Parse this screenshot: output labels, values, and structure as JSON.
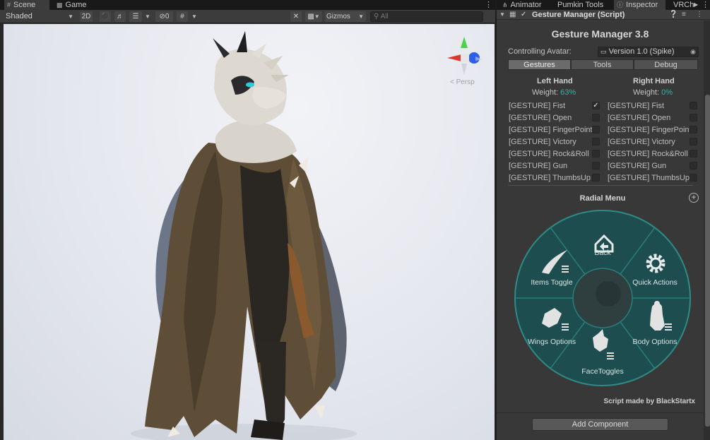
{
  "scene_tabs": [
    {
      "label": "Scene",
      "icon": "hash-grid-icon"
    },
    {
      "label": "Game",
      "icon": "gamepad-icon"
    }
  ],
  "toolbar": {
    "shading_mode": "Shaded",
    "two_d": "2D",
    "hidden_count": "0",
    "gizmos": "Gizmos",
    "search_placeholder": "All"
  },
  "viewport": {
    "persp_label": "< Persp"
  },
  "inspector_tabs": [
    {
      "label": "Animator",
      "icon": "animator-icon"
    },
    {
      "label": "Pumkin Tools",
      "icon": ""
    },
    {
      "label": "Inspector",
      "icon": "info-icon"
    },
    {
      "label": "VRCh",
      "icon": ""
    }
  ],
  "component": {
    "title": "Gesture Manager (Script)",
    "enabled": true
  },
  "gesture_manager": {
    "title": "Gesture Manager 3.8",
    "controlling_avatar_label": "Controlling Avatar:",
    "controlling_avatar_value": "Version 1.0 (Spike)",
    "modes": [
      "Gestures",
      "Tools",
      "Debug"
    ],
    "active_mode": "Gestures",
    "left_hand": {
      "title": "Left Hand",
      "weight_label": "Weight:",
      "weight_value": "63%",
      "gestures": [
        {
          "label": "[GESTURE] Fist",
          "checked": true
        },
        {
          "label": "[GESTURE] Open",
          "checked": false
        },
        {
          "label": "[GESTURE] FingerPoint",
          "checked": false
        },
        {
          "label": "[GESTURE] Victory",
          "checked": false
        },
        {
          "label": "[GESTURE] Rock&Roll",
          "checked": false
        },
        {
          "label": "[GESTURE] Gun",
          "checked": false
        },
        {
          "label": "[GESTURE] ThumbsUp",
          "checked": false
        }
      ]
    },
    "right_hand": {
      "title": "Right Hand",
      "weight_label": "Weight:",
      "weight_value": "0%",
      "gestures": [
        {
          "label": "[GESTURE] Fist",
          "checked": false
        },
        {
          "label": "[GESTURE] Open",
          "checked": false
        },
        {
          "label": "[GESTURE] FingerPoint",
          "checked": false
        },
        {
          "label": "[GESTURE] Victory",
          "checked": false
        },
        {
          "label": "[GESTURE] Rock&Roll",
          "checked": false
        },
        {
          "label": "[GESTURE] Gun",
          "checked": false
        },
        {
          "label": "[GESTURE] ThumbsUp",
          "checked": false
        }
      ]
    },
    "radial_menu": {
      "title": "Radial Menu",
      "items": [
        {
          "label": "Back",
          "icon": "back-home-icon"
        },
        {
          "label": "Quick Actions",
          "icon": "gear-icon"
        },
        {
          "label": "Body Options",
          "icon": "body-submenu-icon"
        },
        {
          "label": "FaceToggles",
          "icon": "face-submenu-icon"
        },
        {
          "label": "Wings Options",
          "icon": "wings-submenu-icon"
        },
        {
          "label": "Items Toggle",
          "icon": "items-submenu-icon"
        }
      ]
    },
    "credit": "Script made by BlackStartx"
  },
  "add_component": "Add Component",
  "colors": {
    "accent_teal": "#35b3a6",
    "radial_fill": "#1d4d4f",
    "radial_ring": "#2f8b86",
    "viewport_sky": "#e4e7ee"
  }
}
